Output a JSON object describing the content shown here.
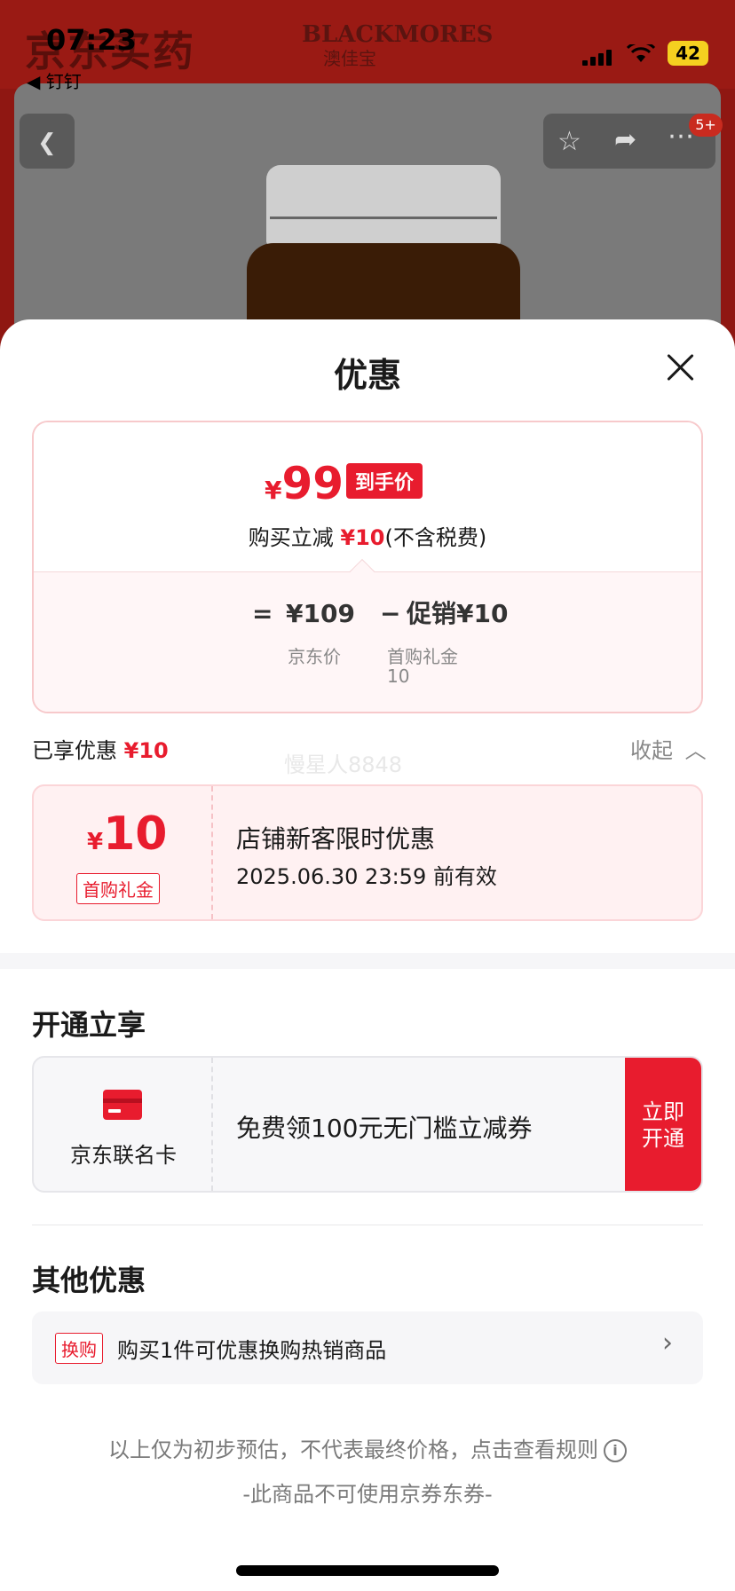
{
  "status": {
    "time": "07:23",
    "back_app": "◀ 钉钉",
    "battery": "42"
  },
  "background": {
    "brand_logo": "京东买药",
    "brand_b": "BLACKMORES",
    "brand_b_sub": "澳佳宝",
    "nav_badge": "5+"
  },
  "sheet": {
    "title": "优惠",
    "final_price": {
      "currency": "¥",
      "amount": "99",
      "tag": "到手价"
    },
    "reduce": {
      "prefix": "购买立减 ",
      "amount": "¥10",
      "suffix": "(不含税费)"
    },
    "breakdown": {
      "equals": "=",
      "jd_price": "¥109",
      "minus": "−",
      "promo": "促销¥10",
      "jd_price_label": "京东价",
      "promo_label": "首购礼金",
      "promo_label_value": "10"
    },
    "enjoyed": {
      "label": "已享优惠 ",
      "amount": "¥10"
    },
    "collapse_label": "收起",
    "watermark": "慢星人8848",
    "coupon": {
      "currency": "¥",
      "amount": "10",
      "tag": "首购礼金",
      "title": "店铺新客限时优惠",
      "expiry": "2025.06.30 23:59 前有效"
    },
    "open_section": {
      "title": "开通立享",
      "card_name": "京东联名卡",
      "description": "免费领100元无门槛立减券",
      "button_line1": "立即",
      "button_line2": "开通"
    },
    "other_section": {
      "title": "其他优惠",
      "tag": "换购",
      "text": "购买1件可优惠换购热销商品"
    },
    "footnote": "以上仅为初步预估，不代表最终价格，点击查看规则",
    "footnote2": "-此商品不可使用京券东券-"
  },
  "colors": {
    "accent_red": "#e81c2e",
    "background_red": "#8f1712"
  },
  "icons": [
    "back-icon",
    "star-icon",
    "share-icon",
    "more-icon",
    "close-icon",
    "chevron-up-icon",
    "card-icon",
    "chevron-right-icon",
    "info-icon"
  ]
}
